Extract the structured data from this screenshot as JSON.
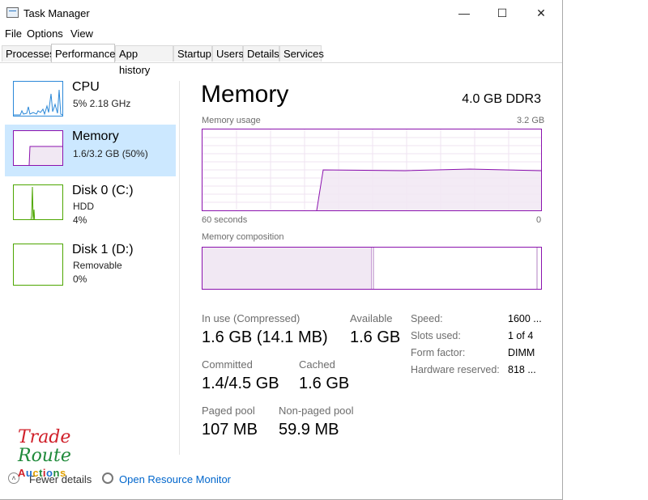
{
  "window": {
    "title": "Task Manager",
    "minimize": "—",
    "maximize": "☐",
    "close": "✕"
  },
  "menu": [
    "File",
    "Options",
    "View"
  ],
  "tabs": [
    "Processes",
    "Performance",
    "App history",
    "Startup",
    "Users",
    "Details",
    "Services"
  ],
  "active_tab": "Performance",
  "sidebar": [
    {
      "name": "CPU",
      "sub1": "5%  2.18 GHz",
      "sub2": "",
      "color": "#2b88d8",
      "selected": false
    },
    {
      "name": "Memory",
      "sub1": "1.6/3.2 GB (50%)",
      "sub2": "",
      "color": "#8b12ae",
      "selected": true
    },
    {
      "name": "Disk 0 (C:)",
      "sub1": "HDD",
      "sub2": "4%",
      "color": "#4da600",
      "selected": false
    },
    {
      "name": "Disk 1 (D:)",
      "sub1": "Removable",
      "sub2": "0%",
      "color": "#4da600",
      "selected": false
    }
  ],
  "main": {
    "title": "Memory",
    "spec": "4.0 GB DDR3",
    "usage_label": "Memory usage",
    "usage_max": "3.2 GB",
    "time_left": "60 seconds",
    "time_right": "0",
    "composition_label": "Memory composition",
    "stats": {
      "in_use_label": "In use (Compressed)",
      "in_use_value": "1.6 GB (14.1 MB)",
      "available_label": "Available",
      "available_value": "1.6 GB",
      "committed_label": "Committed",
      "committed_value": "1.4/4.5 GB",
      "cached_label": "Cached",
      "cached_value": "1.6 GB",
      "paged_label": "Paged pool",
      "paged_value": "107 MB",
      "nonpaged_label": "Non-paged pool",
      "nonpaged_value": "59.9 MB"
    },
    "specs": [
      {
        "label": "Speed:",
        "value": "1600 ..."
      },
      {
        "label": "Slots used:",
        "value": "1 of 4"
      },
      {
        "label": "Form factor:",
        "value": "DIMM"
      },
      {
        "label": "Hardware reserved:",
        "value": "818 ..."
      }
    ]
  },
  "footer": {
    "fewer_details": "Fewer details",
    "open_monitor": "Open Resource Monitor"
  },
  "watermark": {
    "line1": "Trade",
    "line2": "Route",
    "line3": "Auctions"
  },
  "colors": {
    "memory": "#8b12ae",
    "cpu": "#2b88d8",
    "disk": "#4da600",
    "selection": "#cce8ff",
    "link": "#0066cc"
  }
}
